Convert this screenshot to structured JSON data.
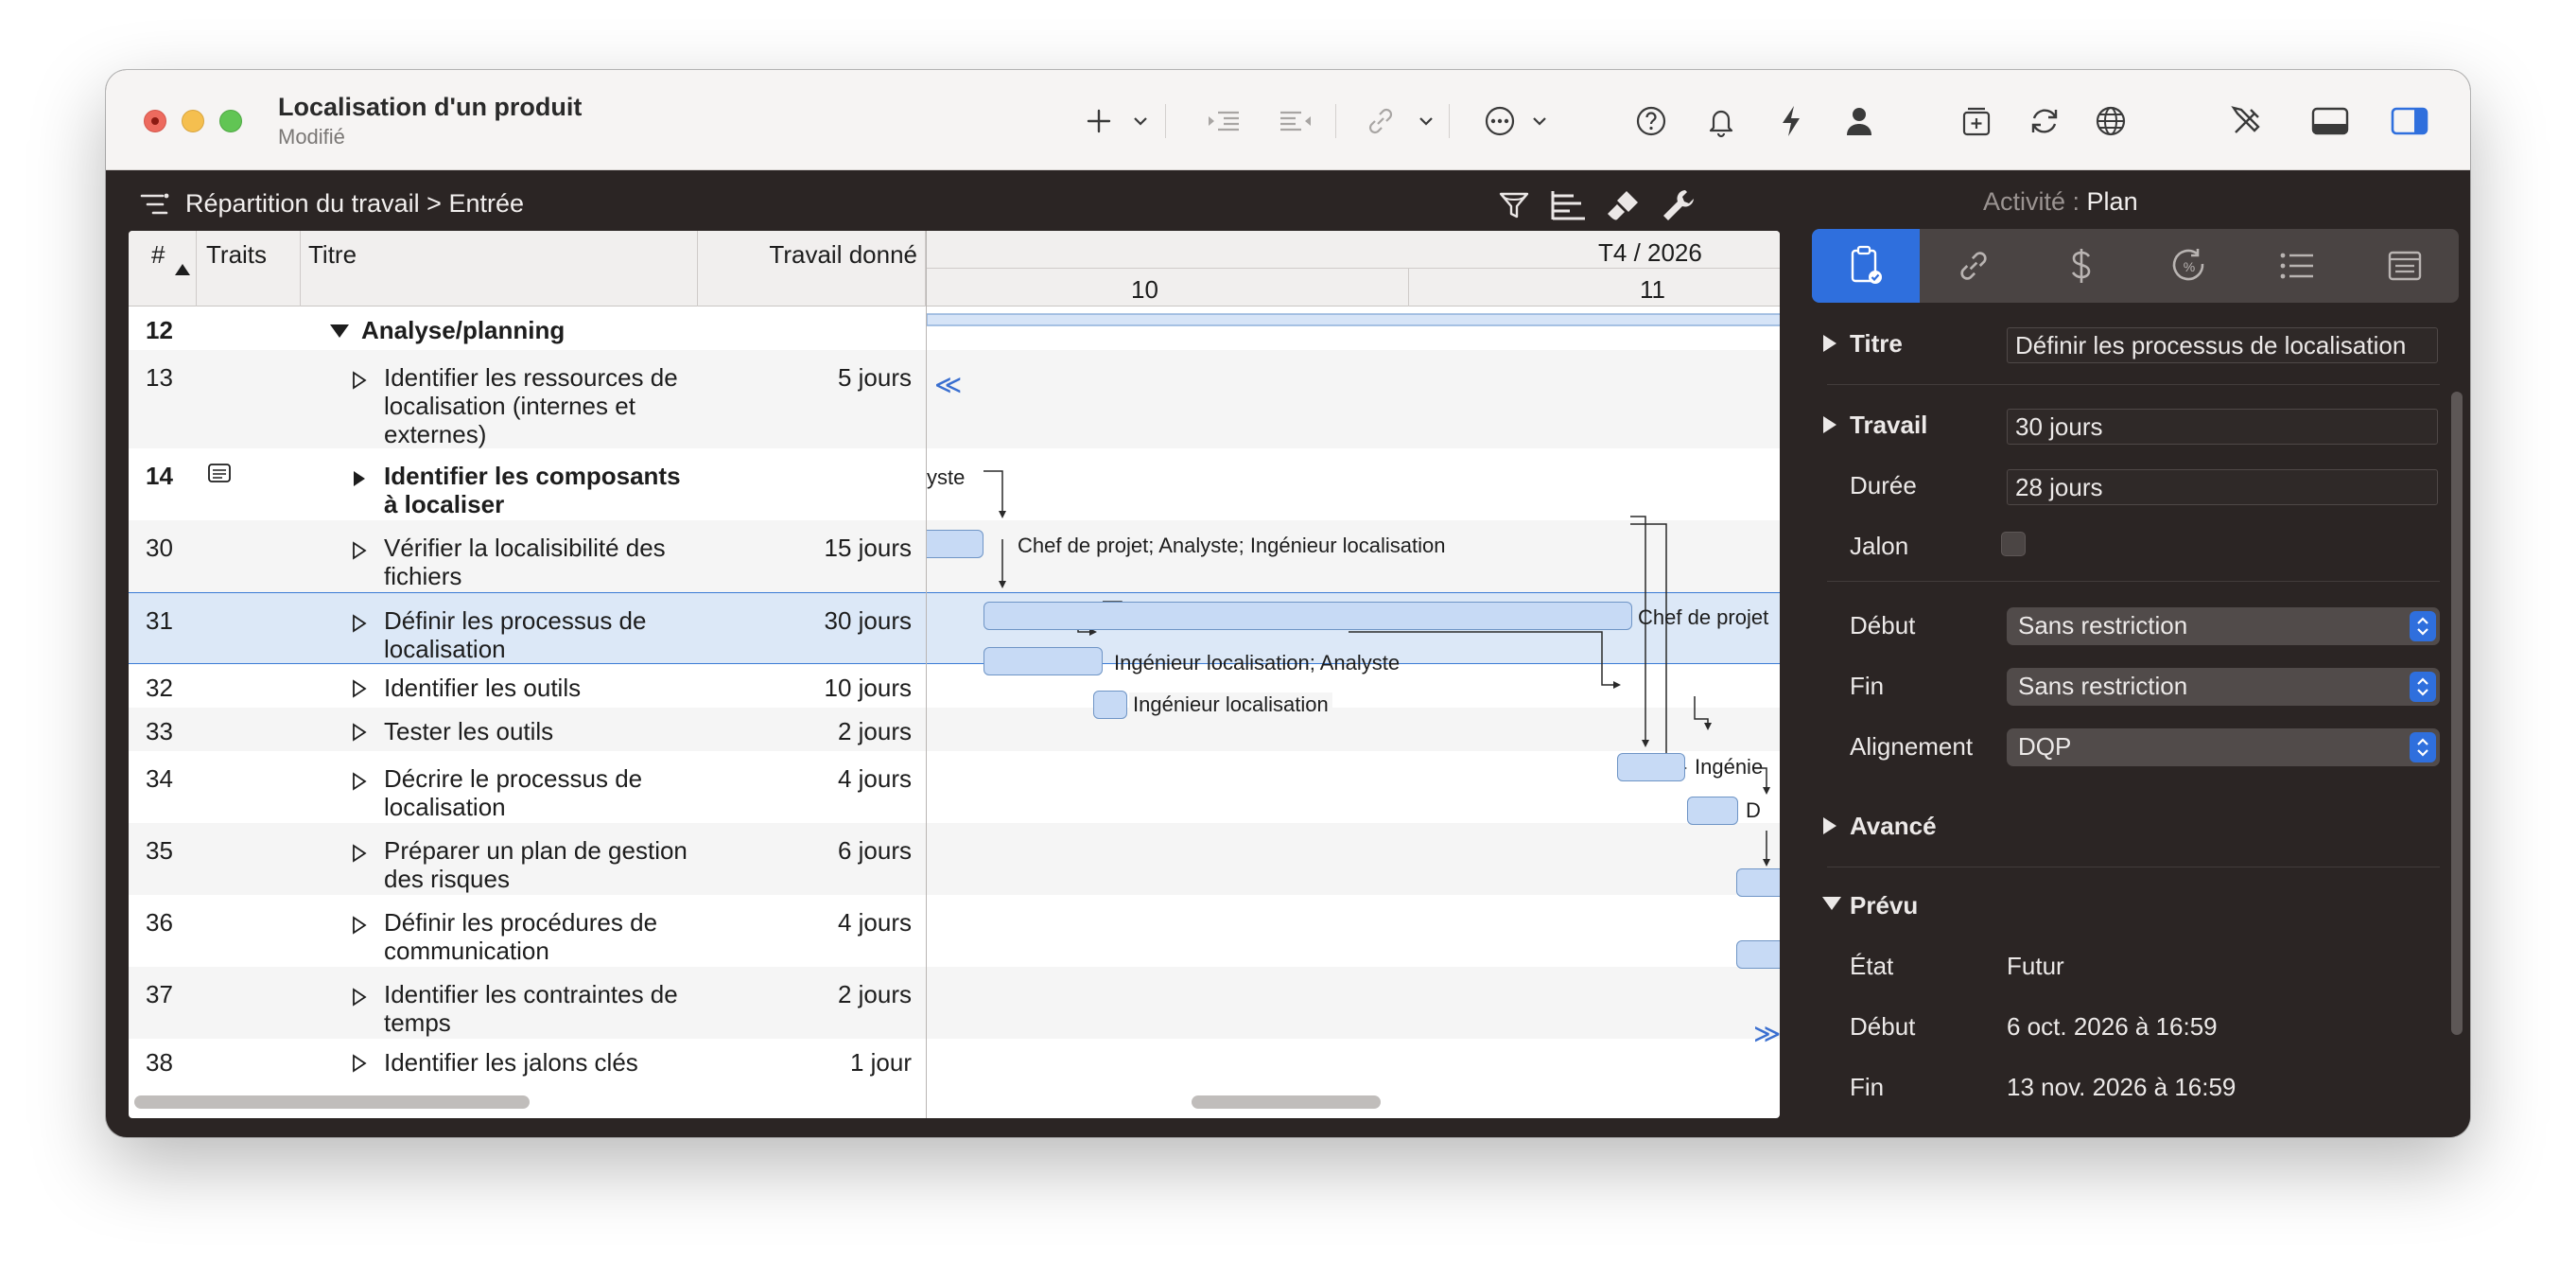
{
  "window": {
    "title": "Localisation d'un produit",
    "subtitle": "Modifié"
  },
  "toolbar": {
    "icons": [
      "plus-icon",
      "chevron-down-icon",
      "indent-icon",
      "outdent-icon",
      "link-icon",
      "chevron-down-icon",
      "more-icon",
      "chevron-down-icon",
      "help-icon",
      "bell-icon",
      "lightning-icon",
      "person-icon",
      "add-resource-icon",
      "sync-icon",
      "globe-icon",
      "tools-icon",
      "bottom-panel-icon",
      "right-sidebar-icon"
    ]
  },
  "breadcrumb": {
    "text": "Répartition du travail",
    "separator": ">",
    "current": "Entrée"
  },
  "activity": {
    "label": "Activité :",
    "value": "Plan"
  },
  "table": {
    "headers": {
      "num": "#",
      "traits": "Traits",
      "title": "Titre",
      "work": "Travail donné"
    },
    "rows": [
      {
        "num": "12",
        "title": "Analyse/planning",
        "work": "",
        "bold": true,
        "group": true
      },
      {
        "num": "13",
        "title": "Identifier les ressources de localisation (internes et externes)",
        "work": "5 jours"
      },
      {
        "num": "14",
        "title": "Identifier les composants à localiser",
        "work": "",
        "bold": true
      },
      {
        "num": "30",
        "title": "Vérifier la localisibilité des fichiers",
        "work": "15 jours"
      },
      {
        "num": "31",
        "title": "Définir les processus de localisation",
        "work": "30 jours"
      },
      {
        "num": "32",
        "title": "Identifier les outils",
        "work": "10 jours"
      },
      {
        "num": "33",
        "title": "Tester les outils",
        "work": "2 jours"
      },
      {
        "num": "34",
        "title": "Décrire le processus de localisation",
        "work": "4 jours"
      },
      {
        "num": "35",
        "title": "Préparer un plan de gestion des risques",
        "work": "6 jours"
      },
      {
        "num": "36",
        "title": "Définir les procédures de communication",
        "work": "4 jours"
      },
      {
        "num": "37",
        "title": "Identifier les contraintes de temps",
        "work": "2 jours"
      },
      {
        "num": "38",
        "title": "Identifier les jalons clés",
        "work": "1 jour"
      }
    ]
  },
  "gantt": {
    "quarter": "T4 / 2026",
    "weeks": [
      "10",
      "11"
    ],
    "labels": {
      "row14": "yste",
      "row30": "Chef de projet; Analyste; Ingénieur localisation",
      "row31": "Chef de projet",
      "row32": "Ingénieur localisation; Analyste",
      "row33": "Ingénieur localisation",
      "row34": "Ingénie",
      "row35": "D"
    },
    "markers": {
      "left": "≪",
      "right": "≫"
    }
  },
  "inspector": {
    "tabs": [
      "task-icon",
      "link-icon",
      "dollar-icon",
      "progress-icon",
      "list-icon",
      "note-icon"
    ],
    "titre_label": "Titre",
    "titre_value": "Définir les processus de localisation",
    "travail_label": "Travail",
    "travail_value": "30 jours",
    "duree_label": "Durée",
    "duree_value": "28 jours",
    "jalon_label": "Jalon",
    "debut_label": "Début",
    "debut_value": "Sans restriction",
    "fin_label": "Fin",
    "fin_value": "Sans restriction",
    "alignement_label": "Alignement",
    "alignement_value": "DQP",
    "avance_label": "Avancé",
    "prevu_label": "Prévu",
    "etat_label": "État",
    "etat_value": "Futur",
    "prevu_debut_label": "Début",
    "prevu_debut_value": "6 oct. 2026 à 16:59",
    "prevu_fin_label": "Fin",
    "prevu_fin_value": "13 nov. 2026 à 16:59"
  },
  "colors": {
    "accent": "#2f6fdd",
    "bar_fill": "#c7daf5",
    "bar_stroke": "#6f95c6",
    "selection": "#dce8f7",
    "dark_bg": "#2b2524"
  }
}
